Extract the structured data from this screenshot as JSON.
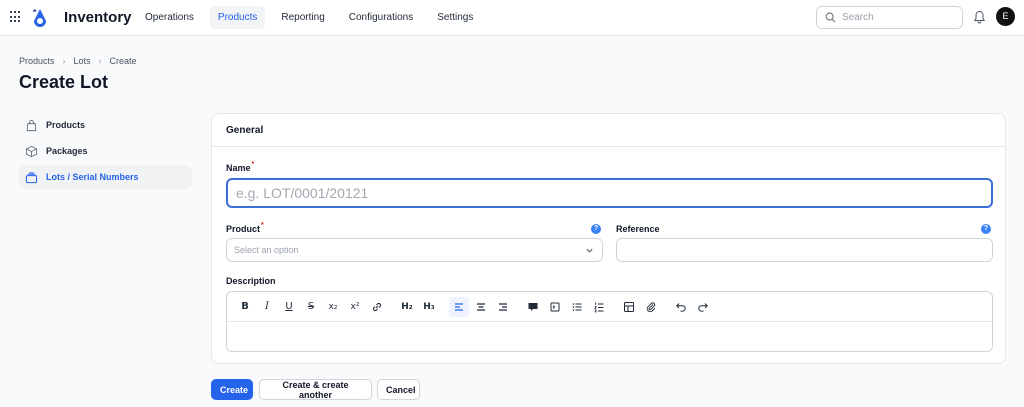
{
  "topbar": {
    "app_name": "Inventory",
    "nav": [
      {
        "label": "Operations",
        "active": false
      },
      {
        "label": "Products",
        "active": true
      },
      {
        "label": "Reporting",
        "active": false
      },
      {
        "label": "Configurations",
        "active": false
      },
      {
        "label": "Settings",
        "active": false
      }
    ],
    "search_placeholder": "Search",
    "avatar_initial": "E"
  },
  "breadcrumb": [
    "Products",
    "Lots",
    "Create"
  ],
  "page_title": "Create Lot",
  "sidebar": {
    "items": [
      {
        "label": "Products",
        "icon": "shopping-bag-icon",
        "active": false
      },
      {
        "label": "Packages",
        "icon": "cube-icon",
        "active": false
      },
      {
        "label": "Lots / Serial Numbers",
        "icon": "rectangle-stack-icon",
        "active": true
      }
    ]
  },
  "form": {
    "section_title": "General",
    "name_label": "Name",
    "name_placeholder": "e.g. LOT/0001/20121",
    "product_label": "Product",
    "product_placeholder": "Select an option",
    "reference_label": "Reference",
    "description_label": "Description",
    "required_mark": "*",
    "help_mark": "?"
  },
  "toolbar_items": [
    {
      "name": "bold",
      "glyph": "B"
    },
    {
      "name": "italic",
      "glyph": "I"
    },
    {
      "name": "underline",
      "glyph": "U"
    },
    {
      "name": "strikethrough",
      "glyph": "S"
    },
    {
      "name": "subscript",
      "glyph": "x₂"
    },
    {
      "name": "superscript",
      "glyph": "x²"
    },
    {
      "name": "link",
      "glyph": ""
    },
    {
      "name": "heading2",
      "glyph": "H₂"
    },
    {
      "name": "heading3",
      "glyph": "H₃"
    },
    {
      "name": "align-left",
      "glyph": "",
      "active": true
    },
    {
      "name": "align-center",
      "glyph": ""
    },
    {
      "name": "align-right",
      "glyph": ""
    },
    {
      "name": "blockquote",
      "glyph": ""
    },
    {
      "name": "code-block",
      "glyph": ""
    },
    {
      "name": "bullet-list",
      "glyph": ""
    },
    {
      "name": "ordered-list",
      "glyph": ""
    },
    {
      "name": "table",
      "glyph": ""
    },
    {
      "name": "attach-files",
      "glyph": ""
    },
    {
      "name": "undo",
      "glyph": ""
    },
    {
      "name": "redo",
      "glyph": ""
    }
  ],
  "actions": {
    "create": "Create",
    "create_another": "Create & create another",
    "cancel": "Cancel"
  },
  "colors": {
    "accent": "#2563eb",
    "required": "#dc2626",
    "help": "#3b82f6"
  }
}
